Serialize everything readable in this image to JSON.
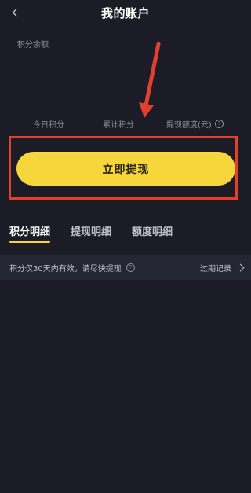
{
  "header": {
    "title": "我的账户",
    "back_icon": "chevron-left-icon"
  },
  "balance": {
    "label": "积分余额"
  },
  "stats": {
    "today_points_label": "今日积分",
    "total_points_label": "累计积分",
    "withdraw_quota_label": "提现额度(元)",
    "info_icon": "info-circle-icon"
  },
  "annotation": {
    "arrow_color": "#e33f2f",
    "box_color": "#e33f2f"
  },
  "actions": {
    "withdraw_button_label": "立即提现",
    "button_color": "#f6d63b"
  },
  "tabs": [
    {
      "label": "积分明细",
      "active": true
    },
    {
      "label": "提现明细",
      "active": false
    },
    {
      "label": "额度明细",
      "active": false
    }
  ],
  "notice": {
    "text": "积分仅30天内有效，请尽快提现",
    "info_icon": "help-circle-icon",
    "link_label": "过期记录",
    "link_icon": "chevron-right-icon"
  }
}
